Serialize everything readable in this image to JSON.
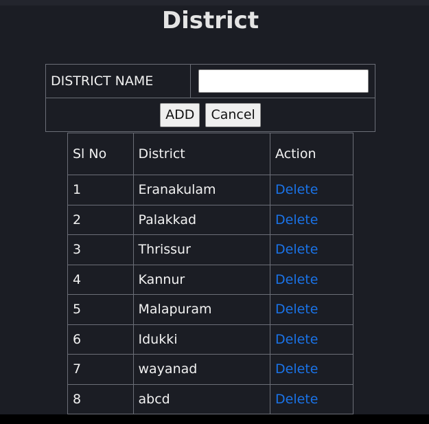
{
  "page": {
    "title": "District"
  },
  "form": {
    "name_label": "DISTRICT NAME",
    "name_value": "",
    "add_label": "ADD",
    "cancel_label": "Cancel"
  },
  "table": {
    "headers": [
      "Sl No",
      "District",
      "Action"
    ],
    "rows": [
      {
        "sl": "1",
        "district": "Eranakulam",
        "action": "Delete"
      },
      {
        "sl": "2",
        "district": "Palakkad",
        "action": "Delete"
      },
      {
        "sl": "3",
        "district": "Thrissur",
        "action": "Delete"
      },
      {
        "sl": "4",
        "district": "Kannur",
        "action": "Delete"
      },
      {
        "sl": "5",
        "district": "Malapuram",
        "action": "Delete"
      },
      {
        "sl": "6",
        "district": "Idukki",
        "action": "Delete"
      },
      {
        "sl": "7",
        "district": "wayanad",
        "action": "Delete"
      },
      {
        "sl": "8",
        "district": "abcd",
        "action": "Delete"
      }
    ]
  },
  "colors": {
    "background": "#1b1d24",
    "text": "#f2f2f2",
    "link": "#1a73e8",
    "border": "#6c6f78"
  }
}
